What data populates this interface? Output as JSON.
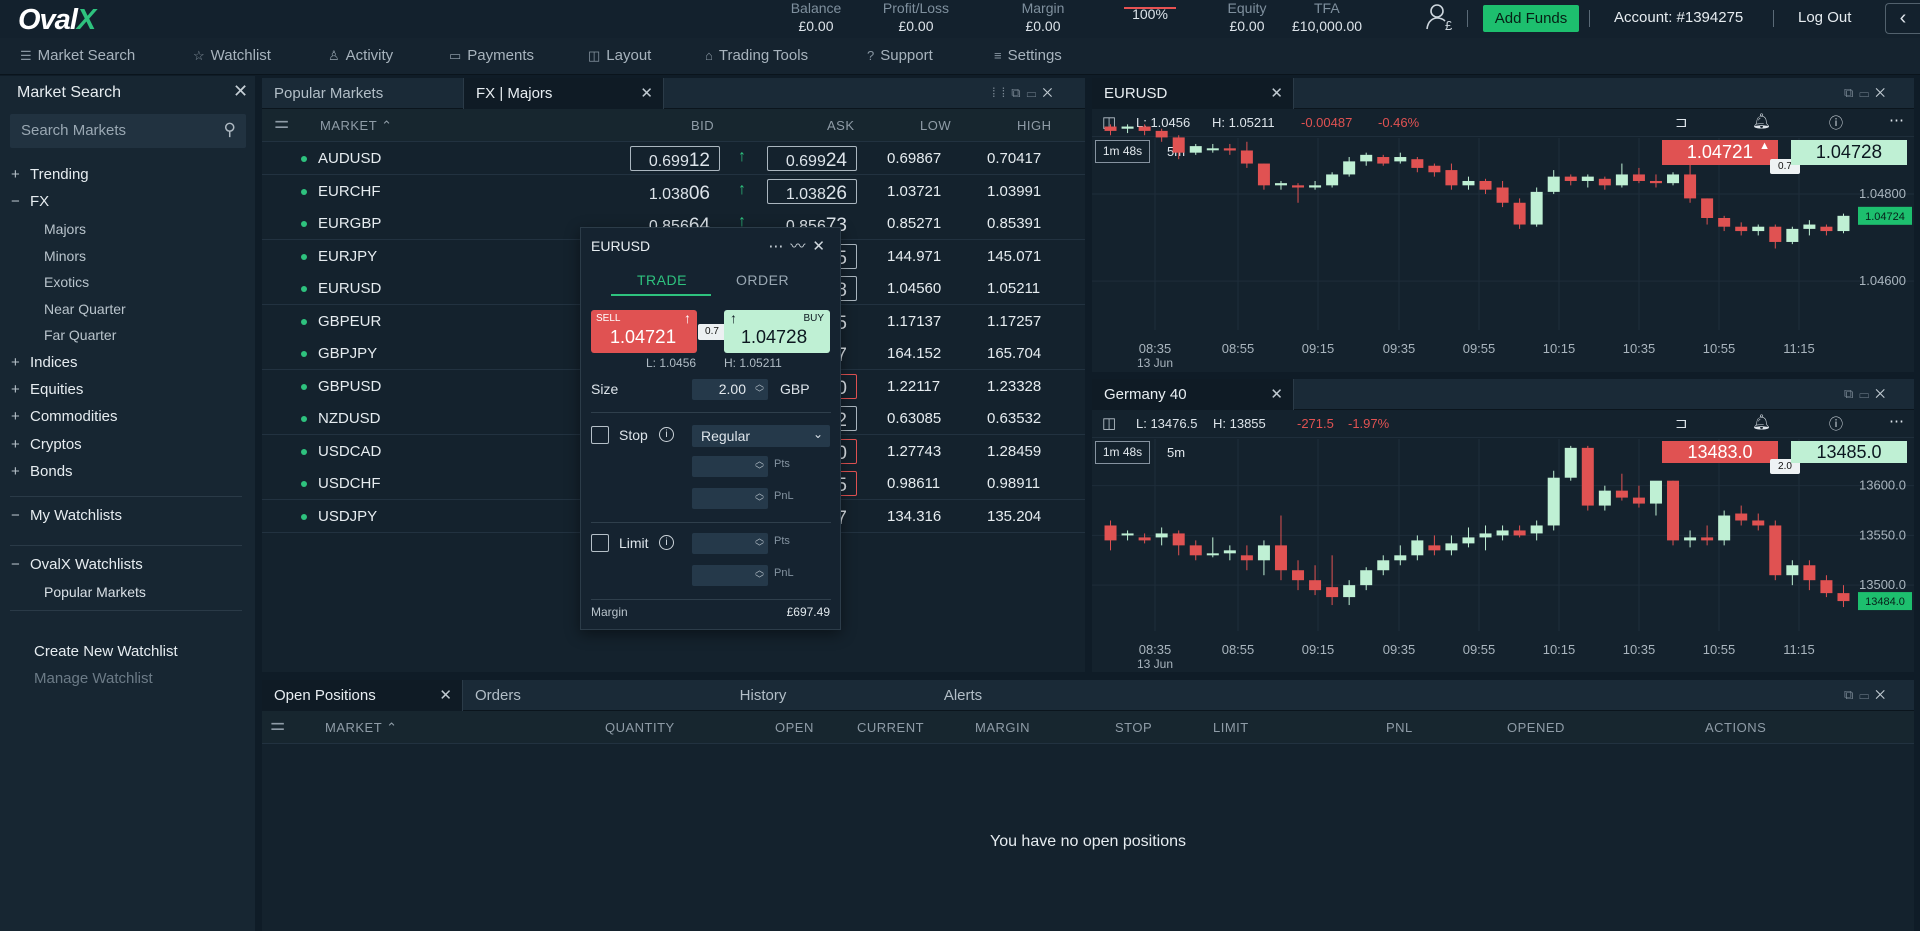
{
  "brand": {
    "logo_main": "Oval",
    "logo_x": "X"
  },
  "topbar": {
    "stats": [
      {
        "label": "Balance",
        "value": "£0.00"
      },
      {
        "label": "Profit/Loss",
        "value": "£0.00"
      },
      {
        "label": "Margin",
        "value": "£0.00"
      },
      {
        "label": "",
        "value": "100%"
      },
      {
        "label": "Equity",
        "value": "£0.00"
      },
      {
        "label": "TFA",
        "value": "£10,000.00"
      }
    ],
    "add_funds": "Add Funds",
    "account": "Account: #1394275",
    "logout": "Log Out",
    "user_icon": "user-pound-icon",
    "collapse_icon": "chevron-left-icon"
  },
  "menu": [
    "Market Search",
    "Watchlist",
    "Activity",
    "Payments",
    "Layout",
    "Trading Tools",
    "Support",
    "Settings"
  ],
  "sidebar": {
    "title": "Market Search",
    "search_placeholder": "Search Markets",
    "tree": [
      {
        "label": "Trending",
        "sign": "+",
        "level": 0
      },
      {
        "label": "FX",
        "sign": "−",
        "level": 0
      },
      {
        "label": "Majors",
        "sign": "",
        "level": 1
      },
      {
        "label": "Minors",
        "sign": "",
        "level": 1
      },
      {
        "label": "Exotics",
        "sign": "",
        "level": 1
      },
      {
        "label": "Near Quarter",
        "sign": "",
        "level": 1
      },
      {
        "label": "Far Quarter",
        "sign": "",
        "level": 1
      },
      {
        "label": "Indices",
        "sign": "+",
        "level": 0
      },
      {
        "label": "Equities",
        "sign": "+",
        "level": 0
      },
      {
        "label": "Commodities",
        "sign": "+",
        "level": 0
      },
      {
        "label": "Cryptos",
        "sign": "+",
        "level": 0
      },
      {
        "label": "Bonds",
        "sign": "+",
        "level": 0
      }
    ],
    "my_watchlists": "My Watchlists",
    "ovalx_watchlists": "OvalX Watchlists",
    "popular_markets": "Popular Markets",
    "create_watchlist": "Create New Watchlist",
    "manage_watchlist": "Manage Watchlist"
  },
  "markets_panel": {
    "tabs": [
      "Popular Markets",
      "FX | Majors"
    ],
    "columns": {
      "market": "MARKET",
      "bid": "BID",
      "ask": "ASK",
      "low": "LOW",
      "high": "HIGH"
    },
    "rows": [
      {
        "market": "AUDUSD",
        "bid_main": "0.699",
        "bid_big": "12",
        "ask_main": "0.699",
        "ask_big": "24",
        "low": "0.69867",
        "high": "0.70417",
        "bid_box": "border",
        "ask_box": "border",
        "up": "↑"
      },
      {
        "market": "EURCHF",
        "bid_main": "1.038",
        "bid_big": "06",
        "ask_main": "1.038",
        "ask_big": "26",
        "low": "1.03721",
        "high": "1.03991",
        "bid_box": "none",
        "ask_box": "border",
        "up": "↑"
      },
      {
        "market": "EURGBP",
        "bid_main": "0.856",
        "bid_big": "64",
        "ask_main": "0.856",
        "ask_big": "73",
        "low": "0.85271",
        "high": "0.85391",
        "bid_box": "none",
        "ask_box": "none",
        "up": "↑"
      },
      {
        "market": "EURJPY",
        "bid_main": "",
        "bid_big": "",
        "ask_main": "",
        "ask_big": "5",
        "low": "144.971",
        "high": "145.071",
        "bid_box": "none",
        "ask_box": "border",
        "up": ""
      },
      {
        "market": "EURUSD",
        "bid_main": "",
        "bid_big": "",
        "ask_main": "",
        "ask_big": "8",
        "low": "1.04560",
        "high": "1.05211",
        "bid_box": "none",
        "ask_box": "border",
        "up": ""
      },
      {
        "market": "GBPEUR",
        "bid_main": "",
        "bid_big": "",
        "ask_main": "",
        "ask_big": "5",
        "low": "1.17137",
        "high": "1.17257",
        "bid_box": "none",
        "ask_box": "none",
        "up": ""
      },
      {
        "market": "GBPJPY",
        "bid_main": "",
        "bid_big": "",
        "ask_main": "",
        "ask_big": "7",
        "low": "164.152",
        "high": "165.704",
        "bid_box": "none",
        "ask_box": "none",
        "up": ""
      },
      {
        "market": "GBPUSD",
        "bid_main": "",
        "bid_big": "",
        "ask_main": "",
        "ask_big": "0",
        "low": "1.22117",
        "high": "1.23328",
        "bid_box": "none",
        "ask_box": "red",
        "up": ""
      },
      {
        "market": "NZDUSD",
        "bid_main": "",
        "bid_big": "",
        "ask_main": "",
        "ask_big": "2",
        "low": "0.63085",
        "high": "0.63532",
        "bid_box": "none",
        "ask_box": "border",
        "up": ""
      },
      {
        "market": "USDCAD",
        "bid_main": "",
        "bid_big": "",
        "ask_main": "",
        "ask_big": "0",
        "low": "1.27743",
        "high": "1.28459",
        "bid_box": "none",
        "ask_box": "red",
        "up": ""
      },
      {
        "market": "USDCHF",
        "bid_main": "",
        "bid_big": "",
        "ask_main": "",
        "ask_big": "5",
        "low": "0.98611",
        "high": "0.98911",
        "bid_box": "none",
        "ask_box": "red",
        "up": ""
      },
      {
        "market": "USDJPY",
        "bid_main": "",
        "bid_big": "",
        "ask_main": "",
        "ask_big": "7",
        "low": "134.316",
        "high": "135.204",
        "bid_box": "none",
        "ask_box": "none",
        "up": ""
      }
    ]
  },
  "ticket": {
    "title": "EURUSD",
    "tab_trade": "TRADE",
    "tab_order": "ORDER",
    "sell_label": "SELL",
    "sell_main": "1.047",
    "sell_big": "21",
    "buy_label": "BUY",
    "buy_main": "1.047",
    "buy_big": "28",
    "spread": "0.7",
    "low": "L: 1.0456",
    "high": "H: 1.05211",
    "size_label": "Size",
    "size_value": "2.00",
    "currency": "GBP",
    "stop_label": "Stop",
    "stop_type": "Regular",
    "limit_label": "Limit",
    "pts": "Pts",
    "pnl": "PnL",
    "margin_label": "Margin",
    "margin_value": "£697.49"
  },
  "chart_data": [
    {
      "type": "candlestick",
      "title": "EURUSD",
      "low": "L: 1.0456",
      "high": "H: 1.05211",
      "change": "-0.00487",
      "change_pct": "-0.46%",
      "timer": "1m 48s",
      "interval": "5m",
      "sell": "1.04721",
      "sell_main": "1.047",
      "sell_big": "21",
      "buy": "1.04728",
      "buy_main": "1.047",
      "buy_big": "28",
      "spread": "0.7",
      "last_price_tag": "1.04724",
      "y_ticks": [
        "1.04800",
        "1.04600"
      ],
      "y_tick_values": [
        1.048,
        1.046
      ],
      "x_ticks": [
        "08:35",
        "08:55",
        "09:15",
        "09:35",
        "09:55",
        "10:15",
        "10:35",
        "10:55",
        "11:15"
      ],
      "x_sub": "13 Jun",
      "ylim": [
        1.0452,
        1.0497
      ],
      "candles": [
        [
          1.04955,
          1.0496,
          1.04935,
          1.04945
        ],
        [
          1.0495,
          1.0496,
          1.0494,
          1.04955
        ],
        [
          1.04955,
          1.0496,
          1.04935,
          1.04945
        ],
        [
          1.04945,
          1.0495,
          1.0492,
          1.0493
        ],
        [
          1.0493,
          1.04935,
          1.0488,
          1.04895
        ],
        [
          1.04895,
          1.04915,
          1.0489,
          1.0491
        ],
        [
          1.04905,
          1.04915,
          1.04895,
          1.04905
        ],
        [
          1.04905,
          1.04915,
          1.0489,
          1.049
        ],
        [
          1.049,
          1.0492,
          1.0486,
          1.0487
        ],
        [
          1.0487,
          1.0487,
          1.0481,
          1.0482
        ],
        [
          1.0482,
          1.0483,
          1.0481,
          1.04825
        ],
        [
          1.0482,
          1.04825,
          1.0478,
          1.04815
        ],
        [
          1.04815,
          1.0483,
          1.0481,
          1.0482
        ],
        [
          1.0482,
          1.0485,
          1.04815,
          1.04845
        ],
        [
          1.04845,
          1.04885,
          1.0484,
          1.04875
        ],
        [
          1.04875,
          1.04895,
          1.04865,
          1.0489
        ],
        [
          1.04885,
          1.0489,
          1.04865,
          1.0487
        ],
        [
          1.04875,
          1.04895,
          1.0487,
          1.04885
        ],
        [
          1.0488,
          1.04885,
          1.0485,
          1.0486
        ],
        [
          1.04865,
          1.0487,
          1.0484,
          1.0485
        ],
        [
          1.04855,
          1.0487,
          1.0481,
          1.0482
        ],
        [
          1.0482,
          1.0484,
          1.0481,
          1.0483
        ],
        [
          1.0483,
          1.04835,
          1.048,
          1.0481
        ],
        [
          1.04815,
          1.0483,
          1.0477,
          1.0478
        ],
        [
          1.0478,
          1.0479,
          1.0472,
          1.0473
        ],
        [
          1.0473,
          1.04815,
          1.04725,
          1.04805
        ],
        [
          1.04805,
          1.04855,
          1.048,
          1.0484
        ],
        [
          1.0484,
          1.04845,
          1.0482,
          1.0483
        ],
        [
          1.0483,
          1.04845,
          1.04815,
          1.0484
        ],
        [
          1.04835,
          1.0484,
          1.0481,
          1.0482
        ],
        [
          1.0482,
          1.0487,
          1.04815,
          1.04845
        ],
        [
          1.04845,
          1.0486,
          1.04825,
          1.0483
        ],
        [
          1.0483,
          1.04845,
          1.04815,
          1.04825
        ],
        [
          1.04825,
          1.0485,
          1.0482,
          1.04845
        ],
        [
          1.04845,
          1.0487,
          1.0478,
          1.0479
        ],
        [
          1.0479,
          1.0479,
          1.0473,
          1.04745
        ],
        [
          1.04745,
          1.0475,
          1.04715,
          1.04725
        ],
        [
          1.04725,
          1.04735,
          1.04705,
          1.04715
        ],
        [
          1.04715,
          1.0473,
          1.04705,
          1.04725
        ],
        [
          1.04725,
          1.0473,
          1.04675,
          1.0469
        ],
        [
          1.0469,
          1.04725,
          1.04685,
          1.0472
        ],
        [
          1.0472,
          1.0474,
          1.04705,
          1.0473
        ],
        [
          1.04725,
          1.0473,
          1.04705,
          1.04715
        ],
        [
          1.04715,
          1.04755,
          1.0471,
          1.0475
        ]
      ]
    },
    {
      "type": "candlestick",
      "title": "Germany 40",
      "low": "L: 13476.5",
      "high": "H: 13855",
      "change": "-271.5",
      "change_pct": "-1.97%",
      "timer": "1m 48s",
      "interval": "5m",
      "sell": "13483.0",
      "buy": "13485.0",
      "spread": "2.0",
      "last_price_tag": "13484.0",
      "y_ticks": [
        "13600.0",
        "13550.0",
        "13500.0"
      ],
      "y_tick_values": [
        13600,
        13550,
        13500
      ],
      "x_ticks": [
        "08:35",
        "08:55",
        "09:15",
        "09:35",
        "09:55",
        "10:15",
        "10:35",
        "10:55",
        "11:15"
      ],
      "x_sub": "13 Jun",
      "ylim": [
        13468,
        13665
      ],
      "candles": [
        [
          13560,
          13565,
          13535,
          13545
        ],
        [
          13550,
          13555,
          13545,
          13552
        ],
        [
          13548,
          13552,
          13542,
          13545
        ],
        [
          13548,
          13558,
          13540,
          13552
        ],
        [
          13552,
          13555,
          13530,
          13540
        ],
        [
          13540,
          13545,
          13525,
          13530
        ],
        [
          13530,
          13548,
          13528,
          13532
        ],
        [
          13532,
          13540,
          13525,
          13535
        ],
        [
          13530,
          13540,
          13515,
          13525
        ],
        [
          13525,
          13545,
          13510,
          13540
        ],
        [
          13540,
          13570,
          13505,
          13515
        ],
        [
          13515,
          13525,
          13495,
          13505
        ],
        [
          13505,
          13520,
          13490,
          13495
        ],
        [
          13498,
          13530,
          13480,
          13488
        ],
        [
          13488,
          13505,
          13480,
          13500
        ],
        [
          13500,
          13518,
          13495,
          13515
        ],
        [
          13515,
          13530,
          13510,
          13525
        ],
        [
          13525,
          13540,
          13520,
          13530
        ],
        [
          13530,
          13550,
          13525,
          13545
        ],
        [
          13540,
          13550,
          13530,
          13535
        ],
        [
          13535,
          13550,
          13530,
          13542
        ],
        [
          13542,
          13558,
          13538,
          13548
        ],
        [
          13548,
          13560,
          13535,
          13552
        ],
        [
          13550,
          13560,
          13545,
          13555
        ],
        [
          13555,
          13560,
          13548,
          13550
        ],
        [
          13552,
          13565,
          13545,
          13560
        ],
        [
          13560,
          13615,
          13555,
          13608
        ],
        [
          13608,
          13640,
          13605,
          13638
        ],
        [
          13638,
          13640,
          13575,
          13580
        ],
        [
          13580,
          13600,
          13575,
          13595
        ],
        [
          13595,
          13612,
          13585,
          13588
        ],
        [
          13588,
          13600,
          13578,
          13582
        ],
        [
          13582,
          13600,
          13570,
          13605
        ],
        [
          13605,
          13605,
          13540,
          13545
        ],
        [
          13545,
          13555,
          13538,
          13548
        ],
        [
          13548,
          13560,
          13540,
          13545
        ],
        [
          13545,
          13575,
          13540,
          13570
        ],
        [
          13572,
          13580,
          13560,
          13565
        ],
        [
          13565,
          13572,
          13555,
          13560
        ],
        [
          13560,
          13565,
          13505,
          13510
        ],
        [
          13510,
          13525,
          13500,
          13520
        ],
        [
          13520,
          13525,
          13495,
          13505
        ],
        [
          13505,
          13510,
          13488,
          13492
        ],
        [
          13492,
          13500,
          13478,
          13484
        ]
      ]
    }
  ],
  "positions_panel": {
    "tabs": [
      "Open Positions",
      "Orders",
      "History",
      "Alerts"
    ],
    "columns": [
      "MARKET",
      "QUANTITY",
      "OPEN",
      "CURRENT",
      "MARGIN",
      "STOP",
      "LIMIT",
      "PNL",
      "OPENED",
      "ACTIONS"
    ],
    "empty": "You have no open positions"
  },
  "colors": {
    "red": "#e05252",
    "green": "#2ec27e",
    "buy": "#bff0d4",
    "candle_up": "#bff0d4",
    "candle_down": "#e05252"
  }
}
